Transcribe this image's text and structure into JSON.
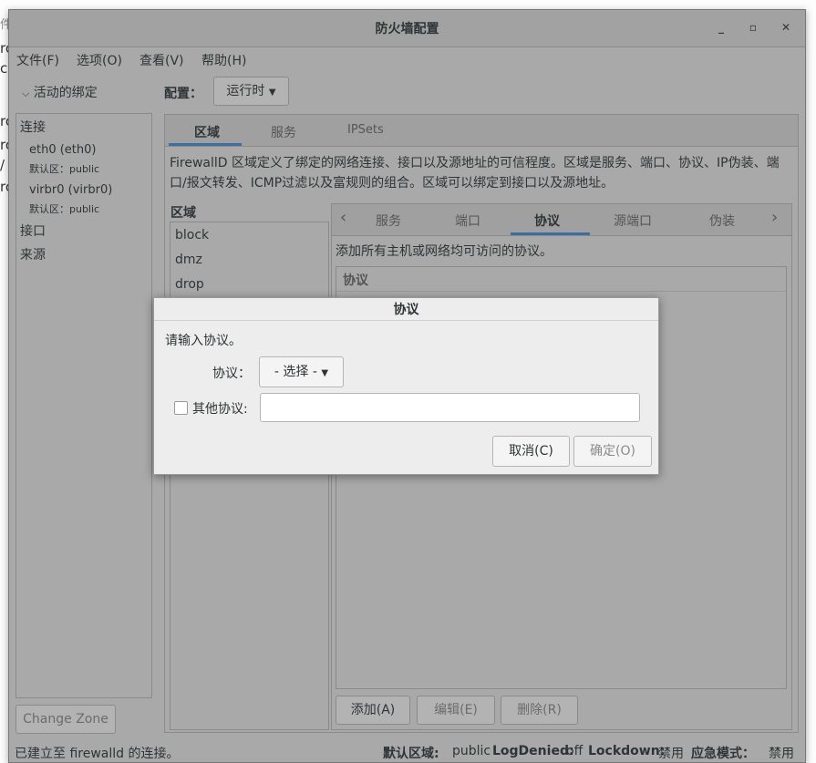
{
  "window": {
    "title": "防火墙配置",
    "minimize_glyph": "_",
    "maximize_glyph": "▫",
    "close_glyph": "✕"
  },
  "background_fragments": [
    "件",
    "rc",
    "c[",
    "rc",
    "rc",
    "/",
    "rc"
  ],
  "menu": {
    "file": "文件(F)",
    "options": "选项(O)",
    "view": "查看(V)",
    "help": "帮助(H)"
  },
  "sidebar": {
    "expander_label": "活动的绑定",
    "connections_header": "连接",
    "connections": [
      {
        "name": "eth0 (eth0)",
        "zone": "默认区：public"
      },
      {
        "name": "virbr0 (virbr0)",
        "zone": "默认区：public"
      }
    ],
    "interfaces_header": "接口",
    "sources_header": "来源",
    "change_zone_button": "Change Zone"
  },
  "config": {
    "label": "配置：",
    "selected": "运行时"
  },
  "main_tabs": [
    "区域",
    "服务",
    "IPSets"
  ],
  "active_main_tab": "区域",
  "zone_description": "FirewallD 区域定义了绑定的网络连接、接口以及源地址的可信程度。区域是服务、端口、协议、IP伪装、端口/报文转发、ICMP过滤以及富规则的组合。区域可以绑定到接口以及源地址。",
  "zones": {
    "header": "区域",
    "items": [
      "block",
      "dmz",
      "drop"
    ]
  },
  "sub_tabs": [
    "服务",
    "端口",
    "协议",
    "源端口",
    "伪装"
  ],
  "active_sub_tab": "协议",
  "protocols_panel": {
    "description": "添加所有主机或网络均可访问的协议。",
    "column_header": "协议",
    "add_button": "添加(A)",
    "edit_button": "编辑(E)",
    "remove_button": "删除(R)"
  },
  "statusbar": {
    "connected_text": "已建立至 firewalld 的连接。",
    "default_zone_label": "默认区域:",
    "default_zone_value": "public",
    "log_denied_label": "LogDenied:",
    "log_denied_value": "off",
    "lockdown_label": "Lockdown:",
    "lockdown_value": "禁用",
    "panic_label": "应急模式：",
    "panic_value": "禁用"
  },
  "dialog": {
    "title": "协议",
    "prompt": "请输入协议。",
    "protocol_label": "协议：",
    "protocol_select": "- 选择 -",
    "other_protocol_label": "其他协议:",
    "other_protocol_value": "",
    "cancel_button": "取消(C)",
    "ok_button": "确定(O)"
  },
  "colors": {
    "accent": "#3d6ea0",
    "window_bg_dimmed": "#a9a9a9",
    "dialog_bg": "#ededed"
  }
}
